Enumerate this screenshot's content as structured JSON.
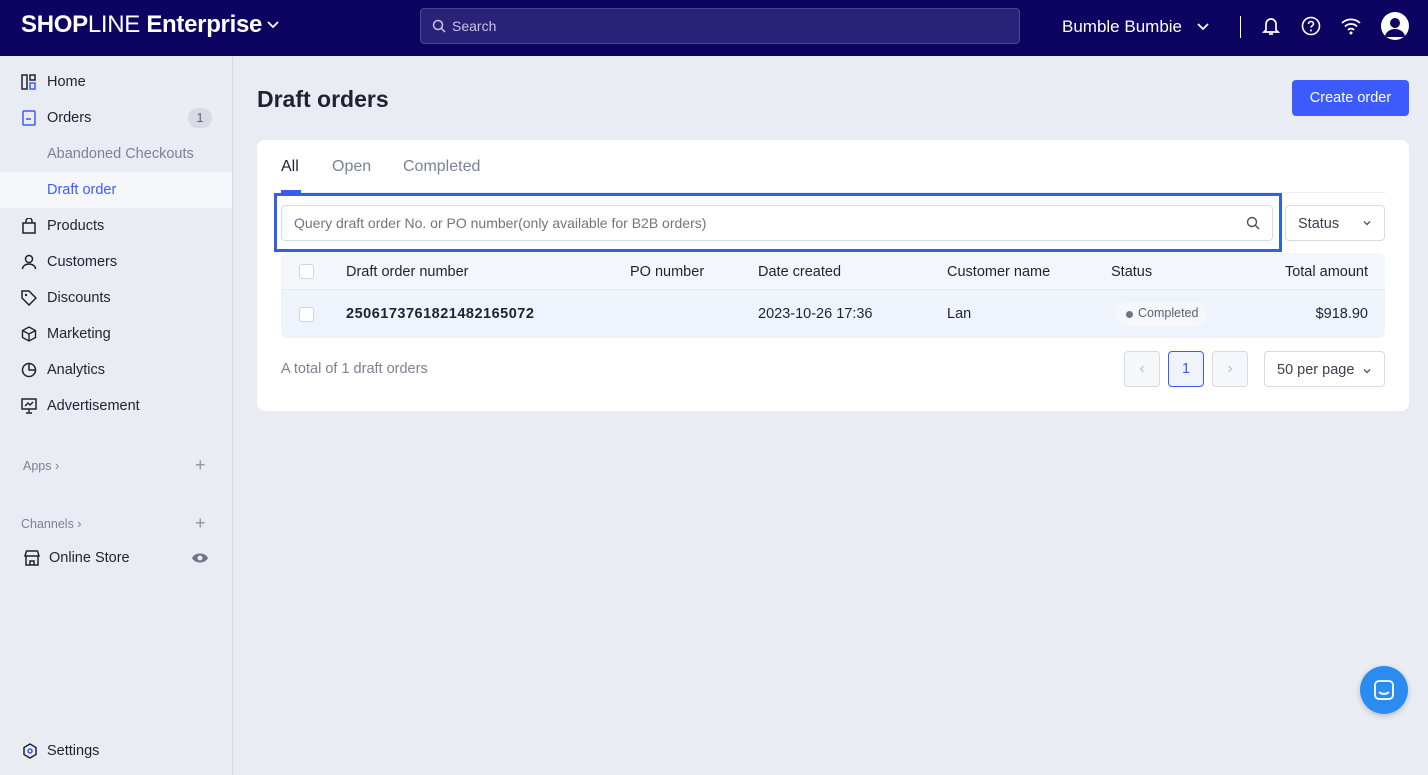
{
  "header": {
    "logo": "SHOPLINE Enterprise",
    "logo_bold": "SHOP",
    "logo_light": "LINE",
    "logo_suffix": " Enterprise",
    "search_placeholder": "Search",
    "store_name": "Bumble Bumbie"
  },
  "sidebar": {
    "items": [
      {
        "label": "Home"
      },
      {
        "label": "Orders",
        "badge": "1"
      },
      {
        "label": "Abandoned Checkouts"
      },
      {
        "label": "Draft order"
      },
      {
        "label": "Products"
      },
      {
        "label": "Customers"
      },
      {
        "label": "Discounts"
      },
      {
        "label": "Marketing"
      },
      {
        "label": "Analytics"
      },
      {
        "label": "Advertisement"
      }
    ],
    "apps_label": "Apps",
    "channels_label": "Channels",
    "online_store": "Online Store",
    "settings": "Settings"
  },
  "main": {
    "title": "Draft orders",
    "create_label": "Create order",
    "tabs": [
      {
        "label": "All"
      },
      {
        "label": "Open"
      },
      {
        "label": "Completed"
      }
    ],
    "query_placeholder": "Query draft order No. or PO number(only available for B2B orders)",
    "status_filter": "Status",
    "columns": [
      "Draft order number",
      "PO number",
      "Date created",
      "Customer name",
      "Status",
      "Total amount"
    ],
    "rows": [
      {
        "number": "2506173761821482165072",
        "po": "",
        "date": "2023-10-26 17:36",
        "customer": "Lan",
        "status": "Completed",
        "total": "$918.90"
      }
    ],
    "total_text": "A total of 1 draft orders",
    "current_page": "1",
    "per_page": "50 per page"
  },
  "colors": {
    "header": "#0d0361",
    "accent": "#3d5afe"
  }
}
